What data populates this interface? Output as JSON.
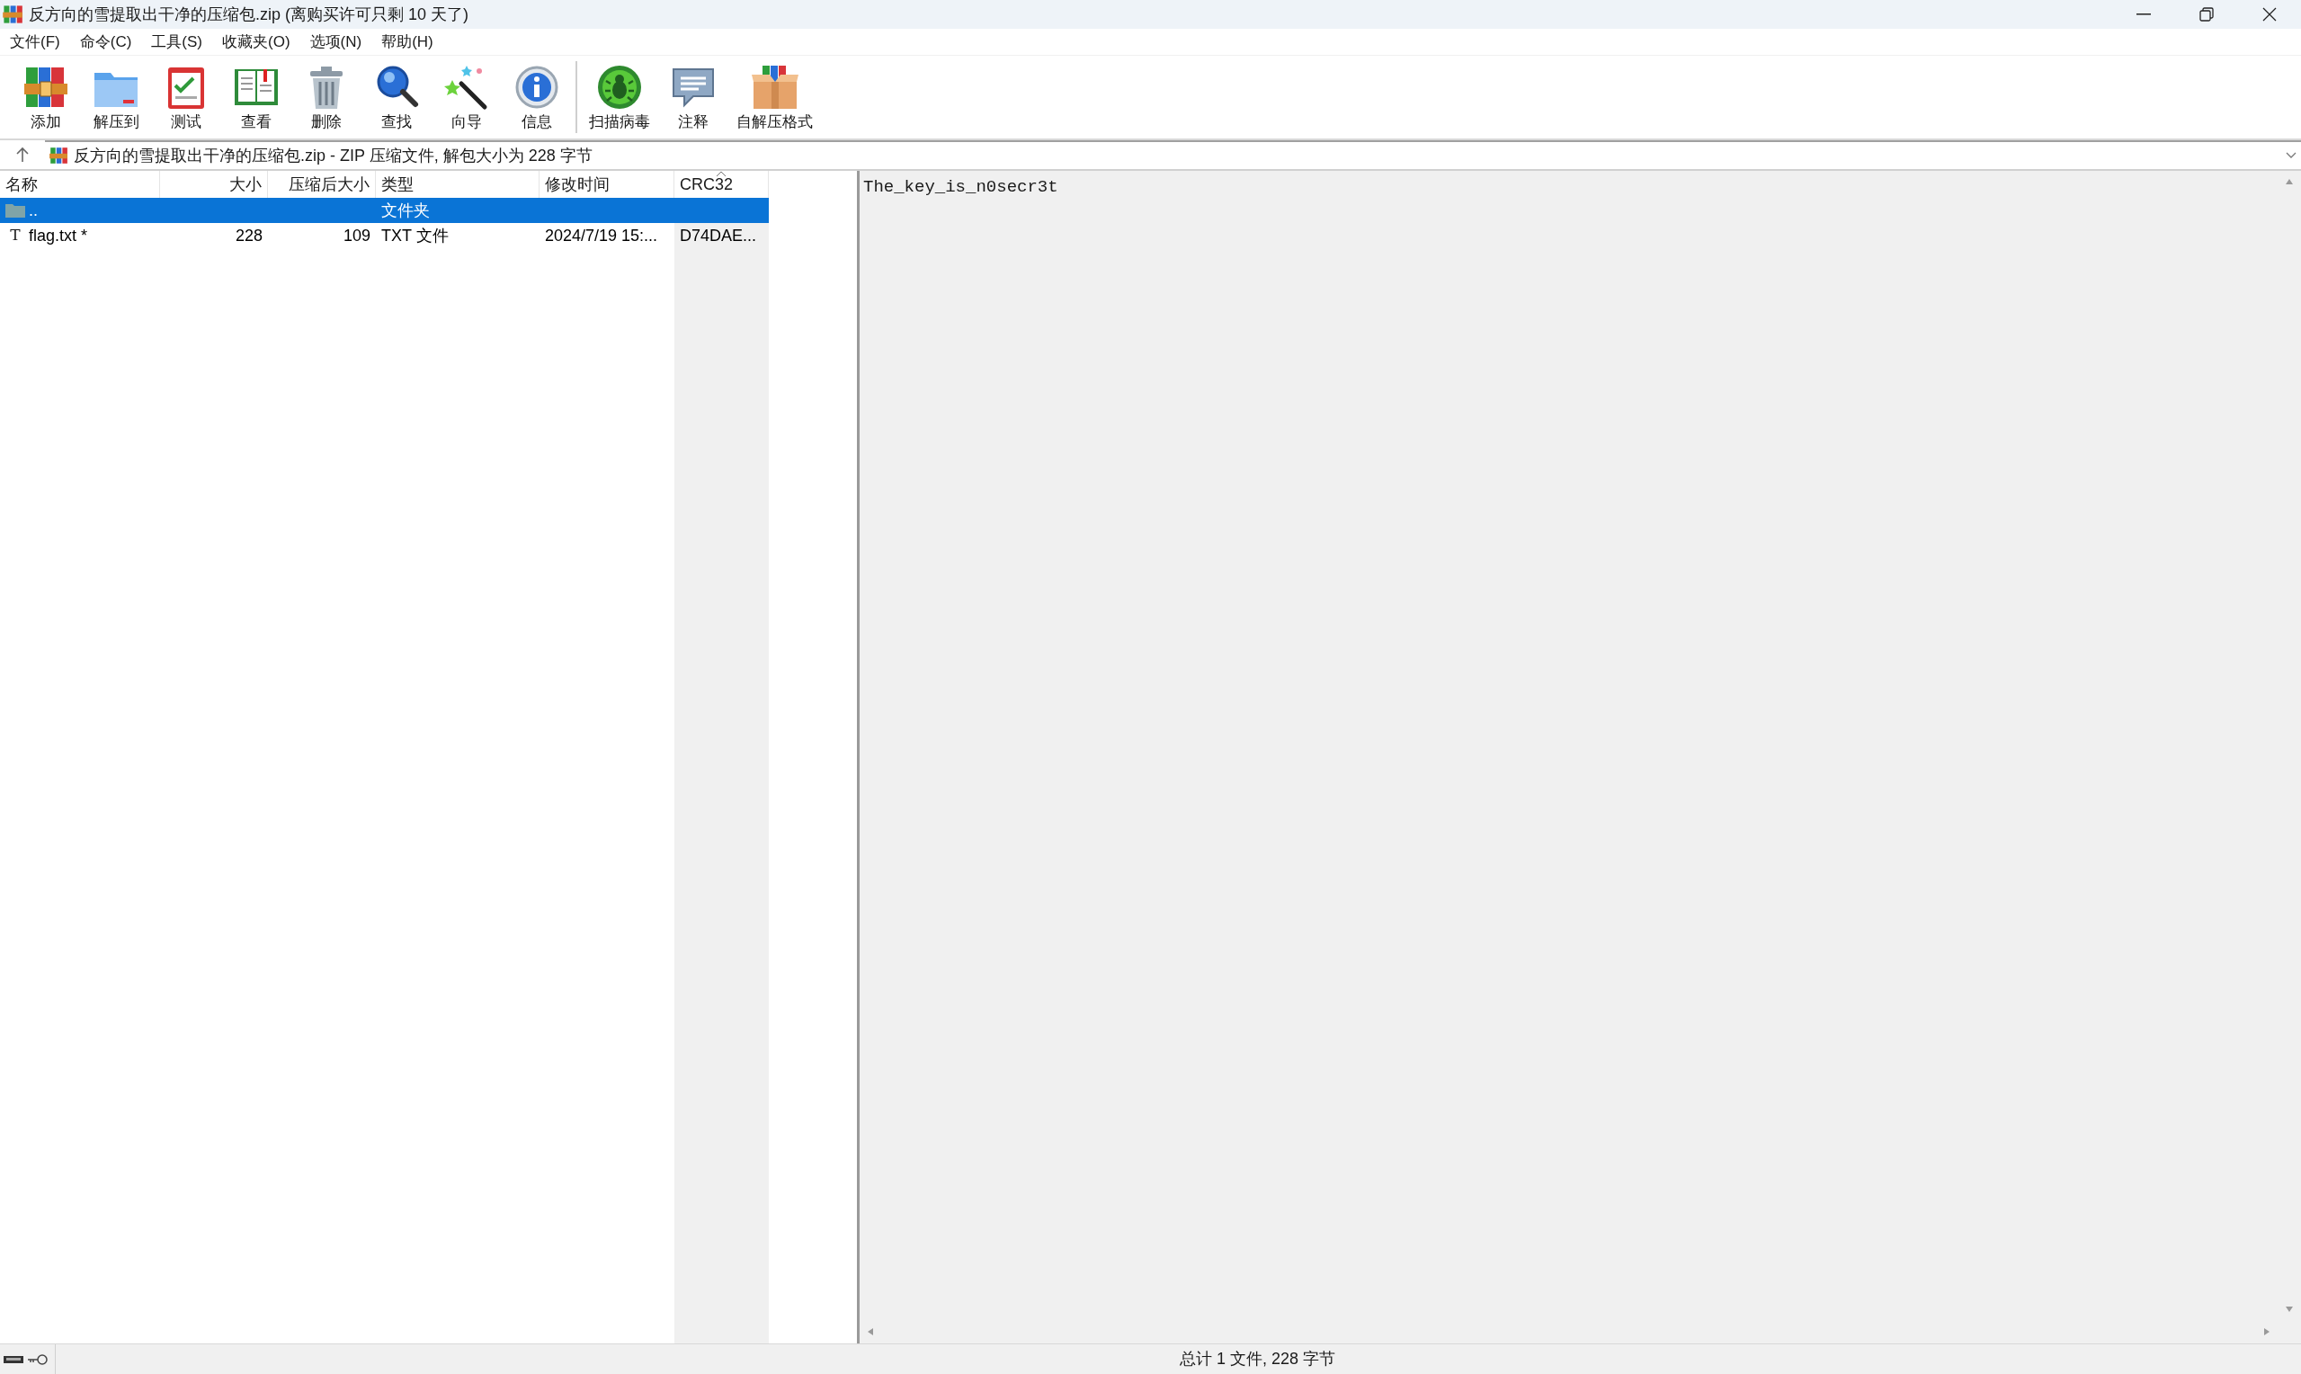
{
  "window": {
    "title": "反方向的雪提取出干净的压缩包.zip (离购买许可只剩 10 天了)"
  },
  "menu": [
    "文件(F)",
    "命令(C)",
    "工具(S)",
    "收藏夹(O)",
    "选项(N)",
    "帮助(H)"
  ],
  "toolbar": [
    {
      "kind": "add",
      "label": "添加"
    },
    {
      "kind": "extract",
      "label": "解压到"
    },
    {
      "kind": "test",
      "label": "测试"
    },
    {
      "kind": "view",
      "label": "查看"
    },
    {
      "kind": "delete",
      "label": "删除"
    },
    {
      "kind": "find",
      "label": "查找"
    },
    {
      "kind": "wizard",
      "label": "向导"
    },
    {
      "kind": "info",
      "label": "信息"
    },
    {
      "kind": "scan",
      "label": "扫描病毒"
    },
    {
      "kind": "comment",
      "label": "注释"
    },
    {
      "kind": "sfx",
      "label": "自解压格式"
    }
  ],
  "address": {
    "text": "反方向的雪提取出干净的压缩包.zip - ZIP 压缩文件, 解包大小为 228 字节"
  },
  "columns": [
    {
      "kind": "name",
      "label": "名称",
      "sorted": false
    },
    {
      "kind": "size",
      "label": "大小",
      "sorted": false
    },
    {
      "kind": "packed",
      "label": "压缩后大小",
      "sorted": false
    },
    {
      "kind": "type",
      "label": "类型",
      "sorted": false
    },
    {
      "kind": "modified",
      "label": "修改时间",
      "sorted": false
    },
    {
      "kind": "crc32",
      "label": "CRC32",
      "sorted": true
    }
  ],
  "rows": [
    {
      "kind": "folder",
      "selected": true,
      "name": "..",
      "type": "文件夹"
    },
    {
      "kind": "file",
      "selected": false,
      "icon": "T",
      "name": "flag.txt *",
      "size": "228",
      "packed": "109",
      "type": "TXT 文件",
      "modified": "2024/7/19 15:...",
      "crc32": "D74DAE..."
    }
  ],
  "preview": {
    "text": "The_key_is_n0secr3t"
  },
  "status_bar": {
    "text": "总计 1 文件, 228 字节"
  }
}
